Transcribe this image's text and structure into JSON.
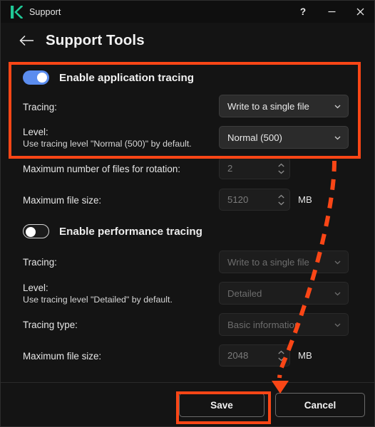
{
  "window": {
    "logo_icon": "kaspersky-k-logo",
    "app_title": "Support",
    "help_label": "?",
    "minimize_label": "—",
    "close_label": "×"
  },
  "header": {
    "back_icon": "arrow-left-icon",
    "page_title": "Support Tools"
  },
  "application_tracing": {
    "toggle_label": "Enable application tracing",
    "toggle_state": "on",
    "tracing": {
      "label": "Tracing:",
      "value": "Write to a single file"
    },
    "level": {
      "label": "Level:",
      "sublabel": "Use tracing level \"Normal (500)\" by default.",
      "value": "Normal (500)"
    },
    "max_files": {
      "label": "Maximum number of files for rotation:",
      "value": "2"
    },
    "max_file_size": {
      "label": "Maximum file size:",
      "value": "5120",
      "unit": "MB"
    }
  },
  "performance_tracing": {
    "toggle_label": "Enable performance tracing",
    "toggle_state": "off",
    "tracing": {
      "label": "Tracing:",
      "value": "Write to a single file"
    },
    "level": {
      "label": "Level:",
      "sublabel": "Use tracing level \"Detailed\" by default.",
      "value": "Detailed"
    },
    "tracing_type": {
      "label": "Tracing type:",
      "value": "Basic information"
    },
    "max_file_size": {
      "label": "Maximum file size:",
      "value": "2048",
      "unit": "MB"
    }
  },
  "footer": {
    "save_label": "Save",
    "cancel_label": "Cancel"
  },
  "annotations": {
    "highlight_color": "#fa4616",
    "highlight_top_target": "application-tracing-settings",
    "highlight_save_target": "save-button",
    "arrow": "dashed-curved-arrow-to-save-button"
  },
  "colors": {
    "window_background": "#141414",
    "titlebar_background": "#0f0f0f",
    "logo_green": "#20c997",
    "toggle_on_blue": "#5b8def",
    "accent_orange": "#fa4616"
  }
}
